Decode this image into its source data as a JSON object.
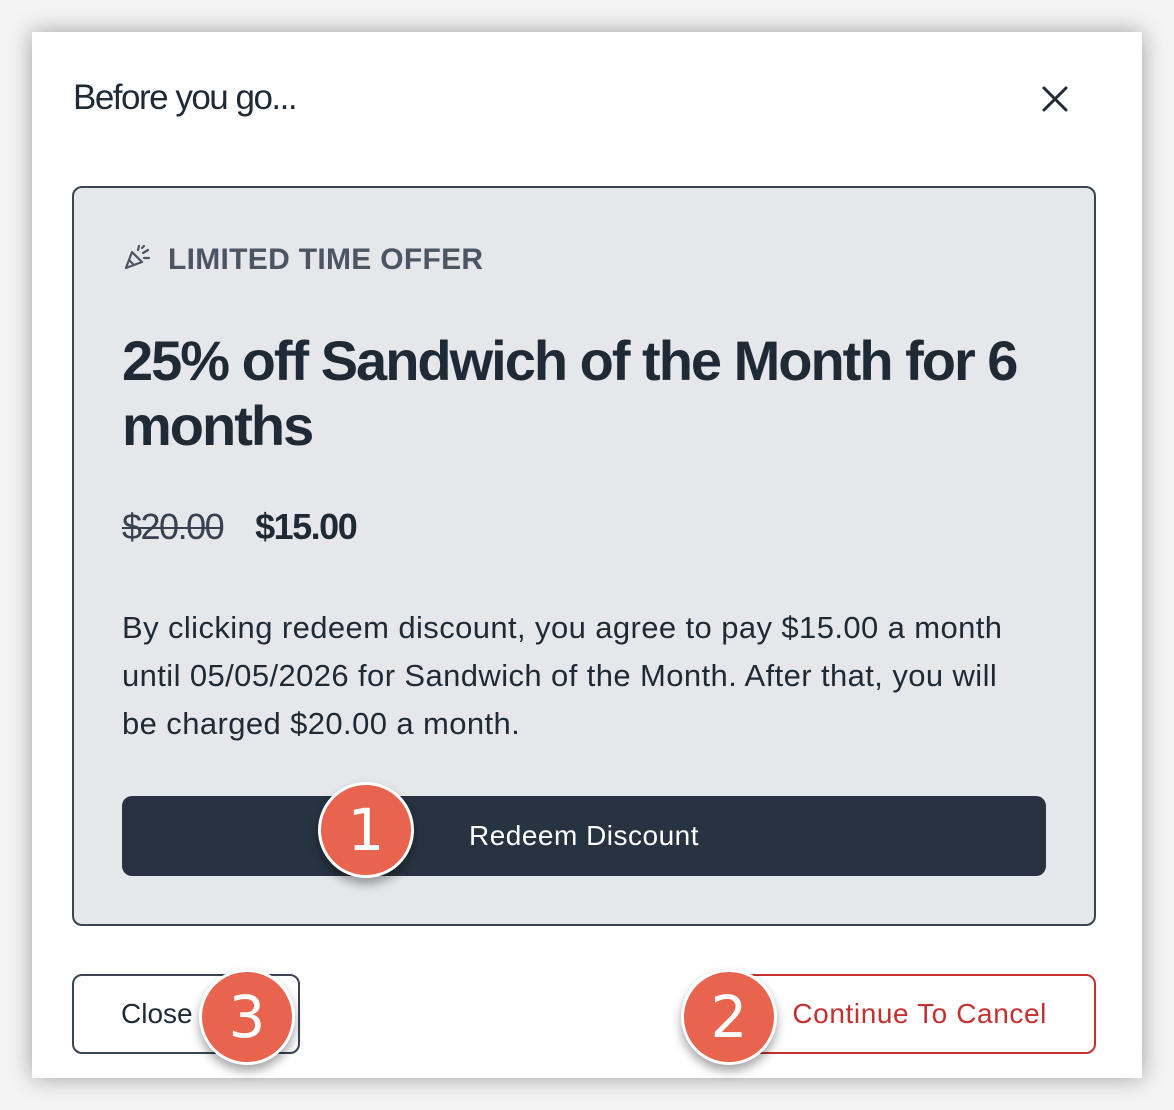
{
  "modal": {
    "title": "Before you go...",
    "close_icon": "close-icon"
  },
  "offer": {
    "tag_icon": "party-popper-icon",
    "tag_label": "LIMITED TIME OFFER",
    "headline": "25% off Sandwich of the Month for 6 months",
    "price_original": "$20.00",
    "price_discounted": "$15.00",
    "terms": "By clicking redeem discount, you agree to pay $15.00 a month until 05/05/2026 for Sandwich of the Month. After that, you will be charged $20.00 a month.",
    "redeem_label": "Redeem Discount"
  },
  "actions": {
    "close_label": "Close",
    "continue_label": "Continue To Cancel"
  },
  "markers": {
    "one": "1",
    "two": "2",
    "three": "3"
  },
  "colors": {
    "primary_dark": "#283342",
    "danger": "#c53030",
    "card_bg": "#e5e7eb",
    "marker": "#e8644f"
  }
}
